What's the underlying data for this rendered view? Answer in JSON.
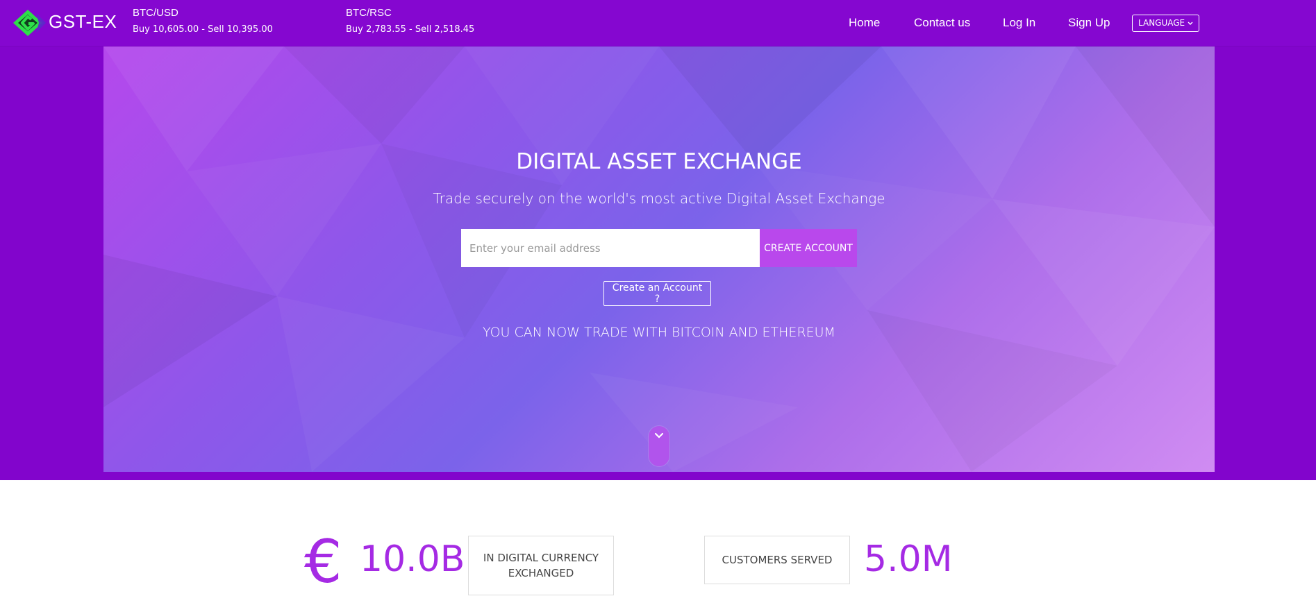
{
  "brand": {
    "name": "GST-EX"
  },
  "tickers": [
    {
      "pair": "BTC/USD",
      "quote": "Buy 10,605.00 - Sell 10,395.00"
    },
    {
      "pair": "BTC/RSC",
      "quote": "Buy 2,783.55 - Sell 2,518.45"
    }
  ],
  "nav": {
    "home": "Home",
    "contact": "Contact us",
    "login": "Log In",
    "signup": "Sign Up",
    "language": "LANGUAGE"
  },
  "hero": {
    "title": "DIGITAL ASSET EXCHANGE",
    "subtitle": "Trade securely on the world's most active Digital Asset Exchange",
    "email_placeholder": "Enter your email address",
    "create_button": "CREATE ACCOUNT",
    "create_link": "Create an Account ?",
    "note": "YOU CAN NOW TRADE WITH BITCOIN AND ETHEREUM"
  },
  "stats": {
    "currency_symbol": "€",
    "exchanged_value": "10.0B",
    "exchanged_label": "IN DIGITAL CURRENCY EXCHANGED",
    "customers_label": "CUSTOMERS SERVED",
    "customers_value": "5.0M"
  },
  "colors": {
    "nav_bg": "#8507d0",
    "accent": "#b948ec",
    "stat_purple": "#a52ae4",
    "logo_green": "#2ee04a"
  },
  "icons": {
    "logo": "gst-ex-logo-icon",
    "language_dropdown": "chevron-down-icon",
    "scroll_down": "chevron-down-icon"
  }
}
